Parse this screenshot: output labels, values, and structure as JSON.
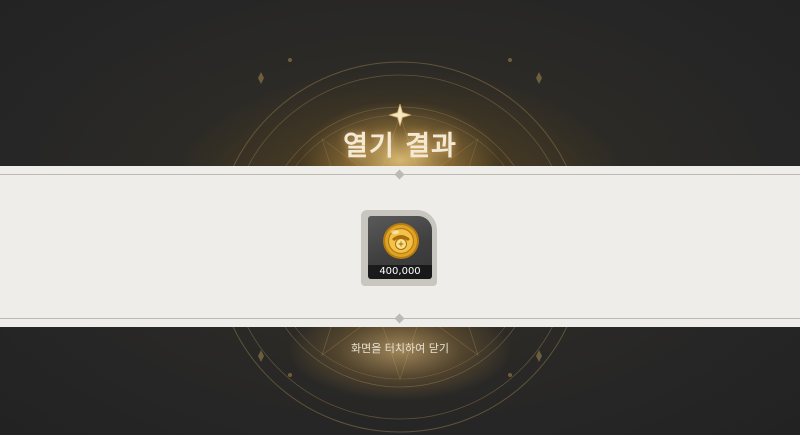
{
  "screen": {
    "title": "열기 결과",
    "close_hint": "화면을 터치하여 닫기"
  },
  "reward": {
    "icon": "gold-coin-icon",
    "quantity": "400,000"
  },
  "colors": {
    "background": "#262626",
    "panel": "#eeedea",
    "title_text": "#f3ead6",
    "coin_gold": "#e0a424"
  }
}
